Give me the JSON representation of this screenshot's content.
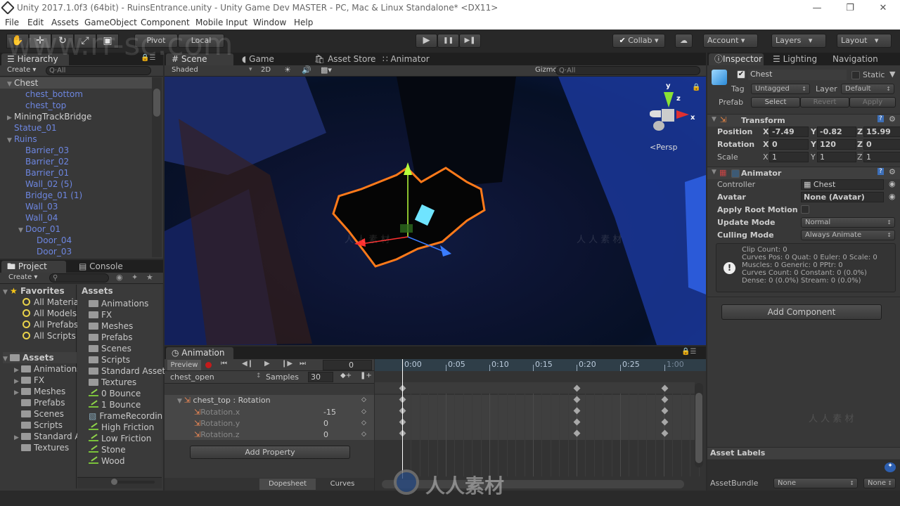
{
  "window": {
    "title": "Unity 2017.1.0f3 (64bit) - RuinsEntrance.unity - Unity Game Dev MASTER - PC, Mac & Linux Standalone* <DX11>",
    "minimize": "—",
    "restore": "❐",
    "close": "✕"
  },
  "menu": [
    "File",
    "Edit",
    "Assets",
    "GameObject",
    "Component",
    "Mobile Input",
    "Window",
    "Help"
  ],
  "toolbar": {
    "tools": [
      "✋",
      "✛",
      "↻",
      "⤢",
      "▣"
    ],
    "pivot": "Pivot",
    "local": "Local",
    "play": "▶",
    "pause": "❚❚",
    "step": "▶❚",
    "collab": "Collab",
    "cloud": "☁",
    "account": "Account",
    "layers": "Layers",
    "layout": "Layout"
  },
  "hierarchy": {
    "tab": "Hierarchy",
    "create": "Create",
    "search": "Q·All",
    "items": [
      {
        "label": "Chest",
        "indent": 1,
        "arrow": "▼",
        "color": "white",
        "selected": true
      },
      {
        "label": "chest_bottom",
        "indent": 3,
        "arrow": "",
        "color": "blue"
      },
      {
        "label": "chest_top",
        "indent": 3,
        "arrow": "",
        "color": "blue"
      },
      {
        "label": "MiningTrackBridge",
        "indent": 1,
        "arrow": "▶",
        "color": "white"
      },
      {
        "label": "Statue_01",
        "indent": 1,
        "arrow": "",
        "color": "blue"
      },
      {
        "label": "Ruins",
        "indent": 1,
        "arrow": "▼",
        "color": "blue"
      },
      {
        "label": "Barrier_03",
        "indent": 3,
        "arrow": "",
        "color": "blue"
      },
      {
        "label": "Barrier_02",
        "indent": 3,
        "arrow": "",
        "color": "blue"
      },
      {
        "label": "Barrier_01",
        "indent": 3,
        "arrow": "",
        "color": "blue"
      },
      {
        "label": "Wall_02 (5)",
        "indent": 3,
        "arrow": "",
        "color": "blue"
      },
      {
        "label": "Bridge_01 (1)",
        "indent": 3,
        "arrow": "",
        "color": "blue"
      },
      {
        "label": "Wall_03",
        "indent": 3,
        "arrow": "",
        "color": "blue"
      },
      {
        "label": "Wall_04",
        "indent": 3,
        "arrow": "",
        "color": "blue"
      },
      {
        "label": "Door_01",
        "indent": 3,
        "arrow": "▼",
        "color": "blue"
      },
      {
        "label": "Door_04",
        "indent": 5,
        "arrow": "",
        "color": "blue"
      },
      {
        "label": "Door_03",
        "indent": 5,
        "arrow": "",
        "color": "blue"
      }
    ]
  },
  "project": {
    "tab": "Project",
    "console_tab": "Console",
    "create": "Create",
    "favorites_label": "Favorites",
    "favorites": [
      "All Materia",
      "All Models",
      "All Prefabs",
      "All Scripts"
    ],
    "assets_label": "Assets",
    "tree": [
      {
        "label": "Animations",
        "arrow": "▶"
      },
      {
        "label": "FX",
        "arrow": "▶"
      },
      {
        "label": "Meshes",
        "arrow": "▶"
      },
      {
        "label": "Prefabs",
        "arrow": ""
      },
      {
        "label": "Scenes",
        "arrow": ""
      },
      {
        "label": "Scripts",
        "arrow": ""
      },
      {
        "label": "Standard A",
        "arrow": "▶"
      },
      {
        "label": "Textures",
        "arrow": ""
      }
    ],
    "grid_header": "Assets",
    "grid": [
      {
        "label": "Animations",
        "type": "folder"
      },
      {
        "label": "FX",
        "type": "folder"
      },
      {
        "label": "Meshes",
        "type": "folder"
      },
      {
        "label": "Prefabs",
        "type": "folder"
      },
      {
        "label": "Scenes",
        "type": "folder"
      },
      {
        "label": "Scripts",
        "type": "folder"
      },
      {
        "label": "Standard Asset",
        "type": "folder"
      },
      {
        "label": "Textures",
        "type": "folder"
      },
      {
        "label": "0 Bounce",
        "type": "physics"
      },
      {
        "label": "1 Bounce",
        "type": "physics"
      },
      {
        "label": "FrameRecordin",
        "type": "script"
      },
      {
        "label": "High Friction",
        "type": "physics"
      },
      {
        "label": "Low Friction",
        "type": "physics"
      },
      {
        "label": "Stone",
        "type": "physics"
      },
      {
        "label": "Wood",
        "type": "physics"
      }
    ]
  },
  "scene": {
    "tabs": [
      "Scene",
      "Game",
      "Asset Store",
      "Animator"
    ],
    "shading": "Shaded",
    "mode2d": "2D",
    "gizmos": "Gizmos",
    "search": "Q·All",
    "persp": "Persp",
    "axis_y": "y",
    "axis_x": "x",
    "axis_z": "z"
  },
  "inspector": {
    "tabs": [
      "Inspector",
      "Lighting",
      "Navigation"
    ],
    "name": "Chest",
    "static": "Static",
    "tag_label": "Tag",
    "tag": "Untagged",
    "layer_label": "Layer",
    "layer": "Default",
    "prefab_label": "Prefab",
    "select": "Select",
    "revert": "Revert",
    "apply": "Apply",
    "transform": {
      "title": "Transform",
      "rows": [
        {
          "label": "Position",
          "x": "-7.49",
          "y": "-0.82",
          "z": "15.99"
        },
        {
          "label": "Rotation",
          "x": "0",
          "y": "120",
          "z": "0"
        },
        {
          "label": "Scale",
          "x": "1",
          "y": "1",
          "z": "1"
        }
      ]
    },
    "animator": {
      "title": "Animator",
      "controller_label": "Controller",
      "controller": "Chest",
      "avatar_label": "Avatar",
      "avatar": "None (Avatar)",
      "root_motion_label": "Apply Root Motion",
      "update_label": "Update Mode",
      "update": "Normal",
      "culling_label": "Culling Mode",
      "culling": "Always Animate",
      "info": [
        "Clip Count: 0",
        "Curves Pos: 0 Quat: 0 Euler: 0 Scale: 0",
        "Muscles: 0 Generic: 0 PPtr: 0",
        "Curves Count: 0 Constant: 0 (0.0%)",
        "Dense: 0 (0.0%) Stream: 0 (0.0%)"
      ]
    },
    "add_component": "Add Component",
    "asset_labels": "Asset Labels",
    "assetbundle_label": "AssetBundle",
    "assetbundle": "None",
    "variant": "None"
  },
  "animation": {
    "tab": "Animation",
    "preview": "Preview",
    "frame": "0",
    "clip": "chest_open",
    "samples_label": "Samples",
    "samples": "30",
    "property_group": "chest_top : Rotation",
    "properties": [
      {
        "label": "Rotation.x",
        "value": "-15"
      },
      {
        "label": "Rotation.y",
        "value": "0"
      },
      {
        "label": "Rotation.z",
        "value": "0"
      }
    ],
    "add_property": "Add Property",
    "dopesheet": "Dopesheet",
    "curves": "Curves",
    "ruler": [
      "0:00",
      "0:05",
      "0:10",
      "0:15",
      "0:20",
      "0:25",
      "1:00"
    ],
    "keyframes_sec": [
      0,
      20,
      30
    ]
  },
  "watermark": {
    "site": "www.rr-sc.com",
    "cn": "人 人 素 材",
    "brand": "人人素材"
  }
}
